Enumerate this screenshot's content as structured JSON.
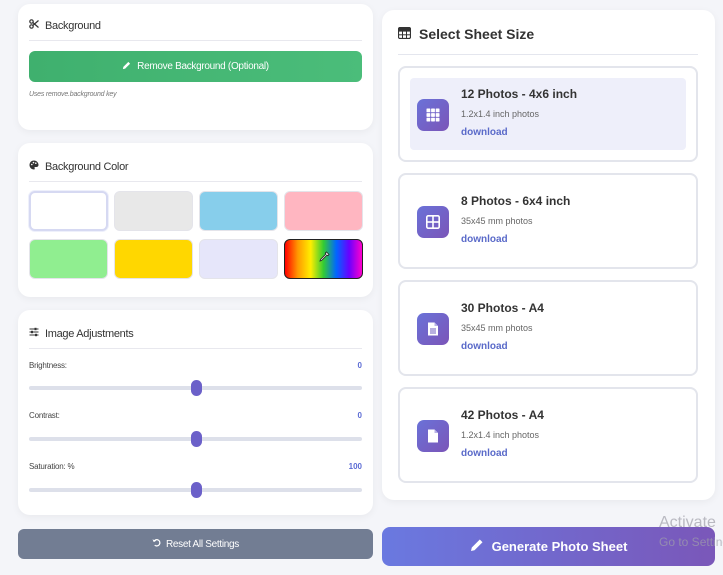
{
  "background_card": {
    "title": "Background",
    "remove_button": "Remove Background (Optional)",
    "hint": "Uses remove.background key"
  },
  "color_card": {
    "title": "Background Color",
    "swatches": [
      {
        "color": "#ffffff",
        "selected": true
      },
      {
        "color": "#e8e8e8"
      },
      {
        "color": "#87ceeb"
      },
      {
        "color": "#ffb6c1"
      },
      {
        "color": "#90ee90"
      },
      {
        "color": "#ffd700"
      },
      {
        "color": "#e6e6fa"
      },
      {
        "color": "rainbow",
        "icon": "eyedropper-icon"
      }
    ]
  },
  "adjust_card": {
    "title": "Image Adjustments",
    "sliders": [
      {
        "label": "Brightness:",
        "value": "0",
        "position": 0.5
      },
      {
        "label": "Contrast:",
        "value": "0",
        "position": 0.5
      },
      {
        "label": "Saturation: %",
        "value": "100",
        "position": 0.5
      }
    ]
  },
  "reset_button": "Reset All Settings",
  "sheet_card": {
    "title": "Select Sheet Size",
    "options": [
      {
        "title": "12 Photos - 4x6 inch",
        "subtitle": "1.2x1.4 inch photos",
        "link": "download",
        "icon": "grid-9-icon",
        "selected": true
      },
      {
        "title": "8 Photos - 6x4 inch",
        "subtitle": "35x45 mm photos",
        "link": "download",
        "icon": "grid-4-icon"
      },
      {
        "title": "30 Photos - A4",
        "subtitle": "35x45 mm photos",
        "link": "download",
        "icon": "document-lines-icon"
      },
      {
        "title": "42 Photos - A4",
        "subtitle": "1.2x1.4 inch photos",
        "link": "download",
        "icon": "document-icon"
      }
    ]
  },
  "generate_button": "Generate Photo Sheet",
  "watermark": {
    "line1": "Activate",
    "line2": "Go to Settings"
  },
  "colors": {
    "accent": "#6b60c9",
    "success": "#3fb06e",
    "reset": "#727d93",
    "link": "#5a6ac9"
  }
}
